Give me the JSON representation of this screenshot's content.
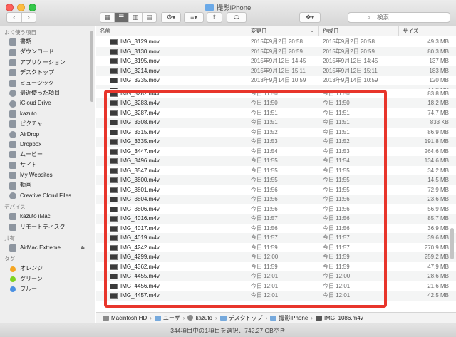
{
  "window": {
    "title": "撮影iPhone"
  },
  "toolbar": {
    "back_icon": "chevron-left-icon",
    "forward_icon": "chevron-right-icon",
    "search_placeholder": "検索"
  },
  "sidebar": {
    "favorites_label": "よく使う項目",
    "favorites": [
      {
        "label": "書類",
        "icon": "document-icon"
      },
      {
        "label": "ダウンロード",
        "icon": "download-icon"
      },
      {
        "label": "アプリケーション",
        "icon": "applications-icon"
      },
      {
        "label": "デスクトップ",
        "icon": "desktop-icon"
      },
      {
        "label": "ミュージック",
        "icon": "music-icon"
      },
      {
        "label": "最近使った項目",
        "icon": "recents-icon"
      },
      {
        "label": "iCloud Drive",
        "icon": "cloud-icon"
      },
      {
        "label": "kazuto",
        "icon": "home-icon"
      },
      {
        "label": "ピクチャ",
        "icon": "pictures-icon"
      },
      {
        "label": "AirDrop",
        "icon": "airdrop-icon"
      },
      {
        "label": "Dropbox",
        "icon": "dropbox-icon"
      },
      {
        "label": "ムービー",
        "icon": "movies-icon"
      },
      {
        "label": "サイト",
        "icon": "folder-icon"
      },
      {
        "label": "My Websites",
        "icon": "folder-icon"
      },
      {
        "label": "動画",
        "icon": "folder-icon"
      },
      {
        "label": "Creative Cloud Files",
        "icon": "creative-cloud-icon"
      }
    ],
    "devices_label": "デバイス",
    "devices": [
      {
        "label": "kazuto iMac",
        "icon": "imac-icon"
      },
      {
        "label": "リモートディスク",
        "icon": "remote-disc-icon"
      }
    ],
    "shared_label": "共有",
    "shared": [
      {
        "label": "AirMac Extreme",
        "icon": "airport-icon"
      }
    ],
    "tags_label": "タグ",
    "tags": [
      {
        "label": "オレンジ",
        "color": "#f5a623"
      },
      {
        "label": "グリーン",
        "color": "#7ed321"
      },
      {
        "label": "ブルー",
        "color": "#4a90e2"
      }
    ]
  },
  "columns": {
    "name": "名前",
    "modified": "変更日",
    "created": "作成日",
    "size": "サイズ"
  },
  "files": [
    {
      "name": "IMG_3129.mov",
      "modified": "2015年9月2日 20:58",
      "created": "2015年9月2日 20:58",
      "size": "49.3 MB"
    },
    {
      "name": "IMG_3130.mov",
      "modified": "2015年9月2日 20:59",
      "created": "2015年9月2日 20:59",
      "size": "80.3 MB"
    },
    {
      "name": "IMG_3195.mov",
      "modified": "2015年9月12日 14:45",
      "created": "2015年9月12日 14:45",
      "size": "137 MB"
    },
    {
      "name": "IMG_3214.mov",
      "modified": "2015年9月12日 15:11",
      "created": "2015年9月12日 15:11",
      "size": "183 MB"
    },
    {
      "name": "IMG_3235.mov",
      "modified": "2013年9月14日 10:59",
      "created": "2013年9月14日 10:59",
      "size": "120 MB"
    },
    {
      "name": "",
      "modified": "",
      "created": "",
      "size": "44.9 MB"
    },
    {
      "name": "IMG_3282.m4v",
      "modified": "今日 11:50",
      "created": "今日 11:50",
      "size": "83.8 MB"
    },
    {
      "name": "IMG_3283.m4v",
      "modified": "今日 11:50",
      "created": "今日 11:50",
      "size": "18.2 MB"
    },
    {
      "name": "IMG_3287.m4v",
      "modified": "今日 11:51",
      "created": "今日 11:51",
      "size": "74.7 MB"
    },
    {
      "name": "IMG_3308.m4v",
      "modified": "今日 11:51",
      "created": "今日 11:51",
      "size": "833 KB"
    },
    {
      "name": "IMG_3315.m4v",
      "modified": "今日 11:52",
      "created": "今日 11:51",
      "size": "86.9 MB"
    },
    {
      "name": "IMG_3335.m4v",
      "modified": "今日 11:53",
      "created": "今日 11:52",
      "size": "191.8 MB"
    },
    {
      "name": "IMG_3447.m4v",
      "modified": "今日 11:54",
      "created": "今日 11:53",
      "size": "264.6 MB"
    },
    {
      "name": "IMG_3496.m4v",
      "modified": "今日 11:55",
      "created": "今日 11:54",
      "size": "134.6 MB"
    },
    {
      "name": "IMG_3547.m4v",
      "modified": "今日 11:55",
      "created": "今日 11:55",
      "size": "34.2 MB"
    },
    {
      "name": "IMG_3800.m4v",
      "modified": "今日 11:55",
      "created": "今日 11:55",
      "size": "14.5 MB"
    },
    {
      "name": "IMG_3801.m4v",
      "modified": "今日 11:56",
      "created": "今日 11:55",
      "size": "72.9 MB"
    },
    {
      "name": "IMG_3804.m4v",
      "modified": "今日 11:56",
      "created": "今日 11:56",
      "size": "23.6 MB"
    },
    {
      "name": "IMG_3806.m4v",
      "modified": "今日 11:56",
      "created": "今日 11:56",
      "size": "56.9 MB"
    },
    {
      "name": "IMG_4016.m4v",
      "modified": "今日 11:57",
      "created": "今日 11:56",
      "size": "85.7 MB"
    },
    {
      "name": "IMG_4017.m4v",
      "modified": "今日 11:56",
      "created": "今日 11:56",
      "size": "36.9 MB"
    },
    {
      "name": "IMG_4019.m4v",
      "modified": "今日 11:57",
      "created": "今日 11:57",
      "size": "39.6 MB"
    },
    {
      "name": "IMG_4242.m4v",
      "modified": "今日 11:59",
      "created": "今日 11:57",
      "size": "270.9 MB"
    },
    {
      "name": "IMG_4299.m4v",
      "modified": "今日 12:00",
      "created": "今日 11:59",
      "size": "259.2 MB"
    },
    {
      "name": "IMG_4362.m4v",
      "modified": "今日 11:59",
      "created": "今日 11:59",
      "size": "47.9 MB"
    },
    {
      "name": "IMG_4455.m4v",
      "modified": "今日 12:01",
      "created": "今日 12:00",
      "size": "28.6 MB"
    },
    {
      "name": "IMG_4456.m4v",
      "modified": "今日 12:01",
      "created": "今日 12:01",
      "size": "21.6 MB"
    },
    {
      "name": "IMG_4457.m4v",
      "modified": "今日 12:01",
      "created": "今日 12:01",
      "size": "42.5 MB"
    }
  ],
  "pathbar": [
    "Macintosh HD",
    "ユーザ",
    "kazuto",
    "デスクトップ",
    "撮影iPhone",
    "IMG_1086.m4v"
  ],
  "status": "344項目中の1項目を選択、742.27 GB空き",
  "colors": {
    "highlight_border": "#e8352b",
    "folder": "#6aa9e8"
  }
}
